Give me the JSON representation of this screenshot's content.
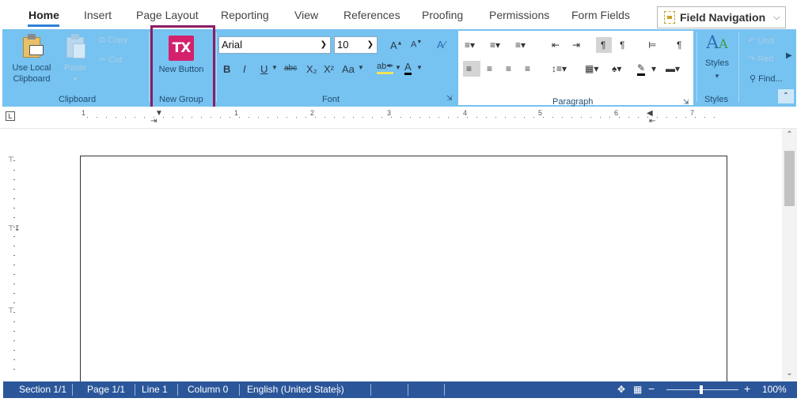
{
  "tabs": [
    {
      "label": "Home",
      "active": true
    },
    {
      "label": "Insert"
    },
    {
      "label": "Page Layout"
    },
    {
      "label": "Reporting"
    },
    {
      "label": "View"
    },
    {
      "label": "References"
    },
    {
      "label": "Proofing"
    },
    {
      "label": "Permissions"
    },
    {
      "label": "Form Fields"
    }
  ],
  "field_navigation": {
    "label": "Field Navigation",
    "icon": "field-navigation-icon"
  },
  "ribbon": {
    "clipboard": {
      "use_local_clipboard": "Use Local Clipboard",
      "paste": "Paste",
      "copy": "Copy",
      "cut": "Cut",
      "group_label": "Clipboard"
    },
    "new_group": {
      "button_label": "New Button",
      "button_icon_text": "TX",
      "group_label": "New Group",
      "highlight_color": "#8c1c63",
      "icon_color": "#d3216e"
    },
    "font": {
      "font_name": "Arial",
      "font_size": "10",
      "bold": "B",
      "italic": "I",
      "underline": "U",
      "strikethrough": "abc",
      "subscript": "X₂",
      "superscript": "X²",
      "change_case": "Aa",
      "grow": "A",
      "shrink": "A",
      "group_label": "Font"
    },
    "paragraph": {
      "group_label": "Paragraph"
    },
    "styles": {
      "label": "Styles",
      "group_label": "Styles"
    },
    "editing": {
      "undo": "Und",
      "redo": "Red",
      "find": "Find..."
    }
  },
  "ruler": {
    "numbers": [
      "1",
      "1",
      "2",
      "3",
      "4",
      "5",
      "6",
      "7"
    ]
  },
  "status_bar": {
    "section": "Section 1/1",
    "page": "Page 1/1",
    "line": "Line 1",
    "column": "Column 0",
    "language": "English (United States)",
    "zoom": "100%",
    "zoom_out": "−",
    "zoom_in": "+"
  },
  "colors": {
    "ribbon": "#76c2f0",
    "status_bar": "#2b579a",
    "accent": "#2f7fd6"
  }
}
